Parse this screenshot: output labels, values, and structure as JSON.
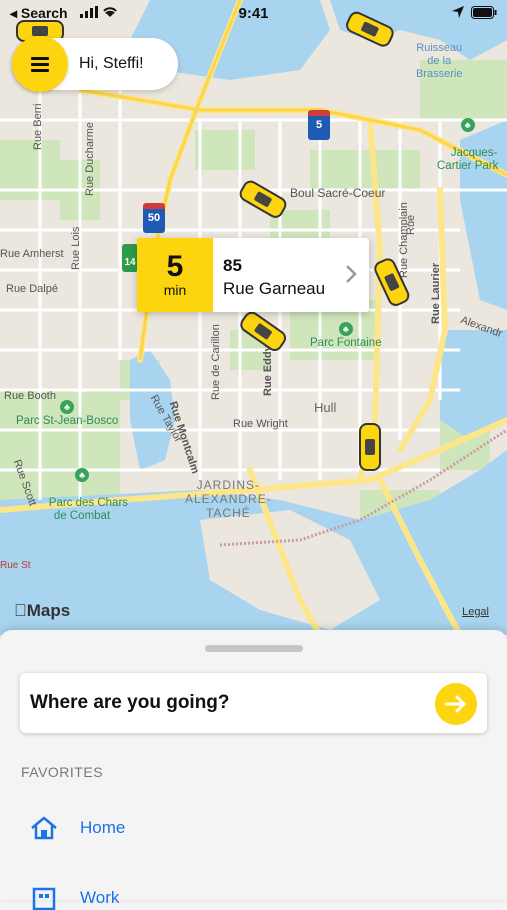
{
  "status_bar": {
    "back_label": "◂ Search",
    "time": "9:41"
  },
  "greeting": {
    "text": "Hi, Steffi!",
    "menu_icon": "hamburger-icon"
  },
  "eta_card": {
    "minutes": "5",
    "unit": "min",
    "address_line1": "85",
    "address_line2": "Rue Garneau"
  },
  "map": {
    "attribution": "Maps",
    "legal": "Legal",
    "labels": {
      "boul_sacre_coeur": "Boul Sacré-Coeur",
      "rue_amherst": "Rue Amherst",
      "rue_dalpe": "Rue Dalpé",
      "rue_booth": "Rue Booth",
      "rue_wright": "Rue Wright",
      "hull": "Hull",
      "parc_fontaine": "Parc Fontaine",
      "parc_st_jean_bosco": "Parc St-Jean-Bosco",
      "parc_des_chars": "Parc des Chars\nde Combat",
      "jacques_cartier": "Jacques-\nCartier Park",
      "ruisseau": "Ruisseau\nde la\nBrasserie",
      "jardins": "JARDINS-\nALEXANDRE-\nTACHÉ",
      "rue_berri": "Rue Berri",
      "rue_ducharme": "Rue Ducharme",
      "rue_lois": "Rue Lois",
      "rue_de_carillon": "Rue de Carillon",
      "rue_eddy": "Rue Eddy",
      "rue_montcalm": "Rue Montcalm",
      "rue_taylor": "Rue Taylor",
      "rue_scott": "Rue Scott",
      "rue_champlain": "Rue Champlain",
      "rue_laurier": "Rue Laurier",
      "rue_st": "Rue St",
      "alexandra": "Alexandr",
      "rue_laval": "Rue",
      "shield_5": "5",
      "shield_50": "50",
      "shield_148": "14"
    }
  },
  "destination": {
    "placeholder": "Where are you going?"
  },
  "favorites": {
    "heading": "FAVORITES",
    "items": [
      {
        "label": "Home",
        "icon": "home-icon"
      },
      {
        "label": "Work",
        "icon": "work-icon"
      }
    ]
  },
  "colors": {
    "accent": "#fcd50f",
    "link": "#1a73e8",
    "water": "#a8d4f0",
    "park": "#c8e6b0"
  }
}
